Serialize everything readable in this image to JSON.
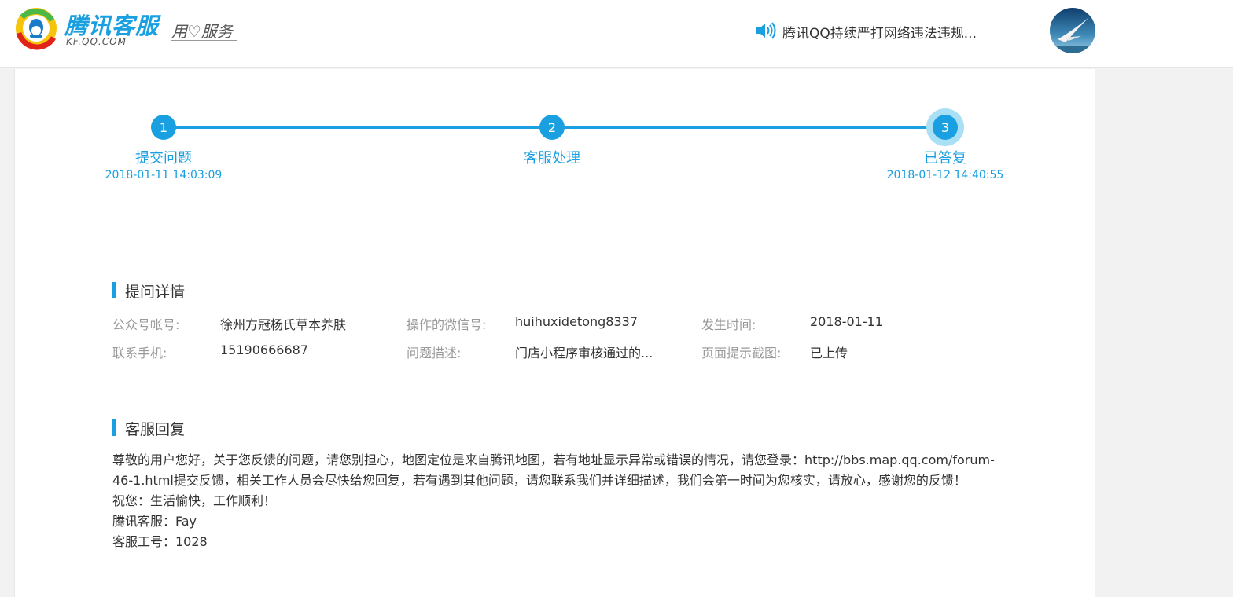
{
  "header": {
    "logo_title": "腾讯客服",
    "logo_sub": "KF.QQ.COM",
    "slogan": "用♡服务",
    "notice": "腾讯QQ持续严打网络违法违规..."
  },
  "progress": {
    "steps": [
      {
        "number": "1",
        "label": "提交问题",
        "time": "2018-01-11 14:03:09"
      },
      {
        "number": "2",
        "label": "客服处理",
        "time": ""
      },
      {
        "number": "3",
        "label": "已答复",
        "time": "2018-01-12 14:40:55"
      }
    ]
  },
  "details": {
    "title": "提问详情",
    "fields": [
      {
        "label": "公众号帐号:",
        "value": "徐州方冠杨氏草本养肤"
      },
      {
        "label": "操作的微信号:",
        "value": "huihuxidetong8337"
      },
      {
        "label": "发生时间:",
        "value": "2018-01-11"
      },
      {
        "label": "联系手机:",
        "value": "15190666687"
      },
      {
        "label": "问题描述:",
        "value": "门店小程序审核通过的..."
      },
      {
        "label": "页面提示截图:",
        "value": "已上传"
      }
    ]
  },
  "reply": {
    "title": "客服回复",
    "lines": [
      "尊敬的用户您好，关于您反馈的问题，请您别担心，地图定位是来自腾讯地图，若有地址显示异常或错误的情况，请您登录：http://bbs.map.qq.com/forum-46-1.html提交反馈，相关工作人员会尽快给您回复，若有遇到其他问题，请您联系我们并详细描述，我们会第一时间为您核实，请放心，感谢您的反馈！",
      "祝您：生活愉快，工作顺利！",
      "腾讯客服：Fay",
      "客服工号：1028"
    ]
  },
  "colors": {
    "accent": "#1aa0e0",
    "label_gray": "#999999",
    "text": "#333333"
  }
}
